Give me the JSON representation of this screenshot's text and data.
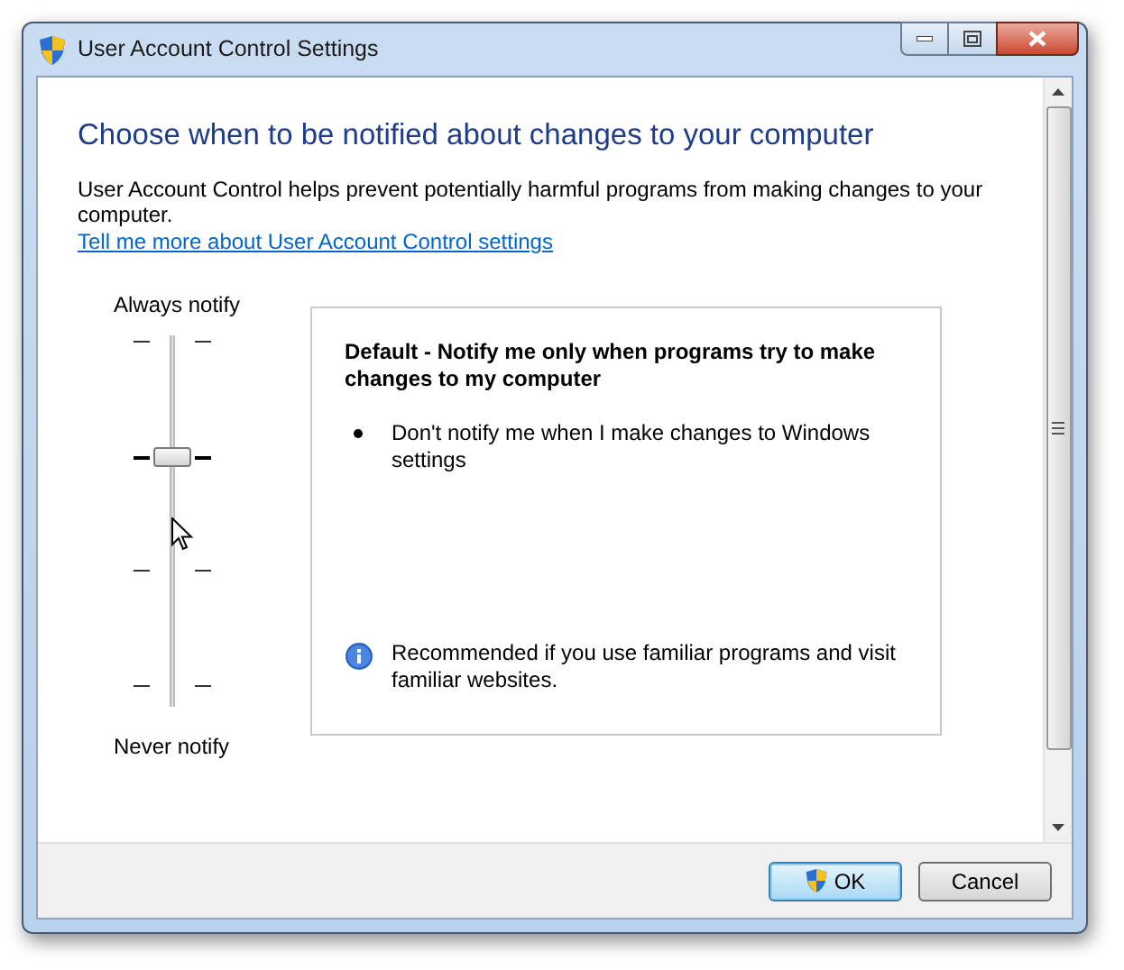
{
  "window": {
    "title": "User Account Control Settings"
  },
  "heading": "Choose when to be notified about changes to your computer",
  "description": "User Account Control helps prevent potentially harmful programs from making changes to your computer.",
  "link": "Tell me more about User Account Control settings",
  "slider": {
    "top_label": "Always notify",
    "bottom_label": "Never notify",
    "level": 0.667
  },
  "info": {
    "title": "Default - Notify me only when programs try to make changes to my computer",
    "bullets": [
      "Don't notify me when I make changes to Windows settings"
    ],
    "recommendation": "Recommended if you use familiar programs and visit familiar websites."
  },
  "buttons": [
    {
      "label": "OK",
      "kind": "primary"
    },
    {
      "label": "Cancel",
      "kind": "normal"
    }
  ]
}
